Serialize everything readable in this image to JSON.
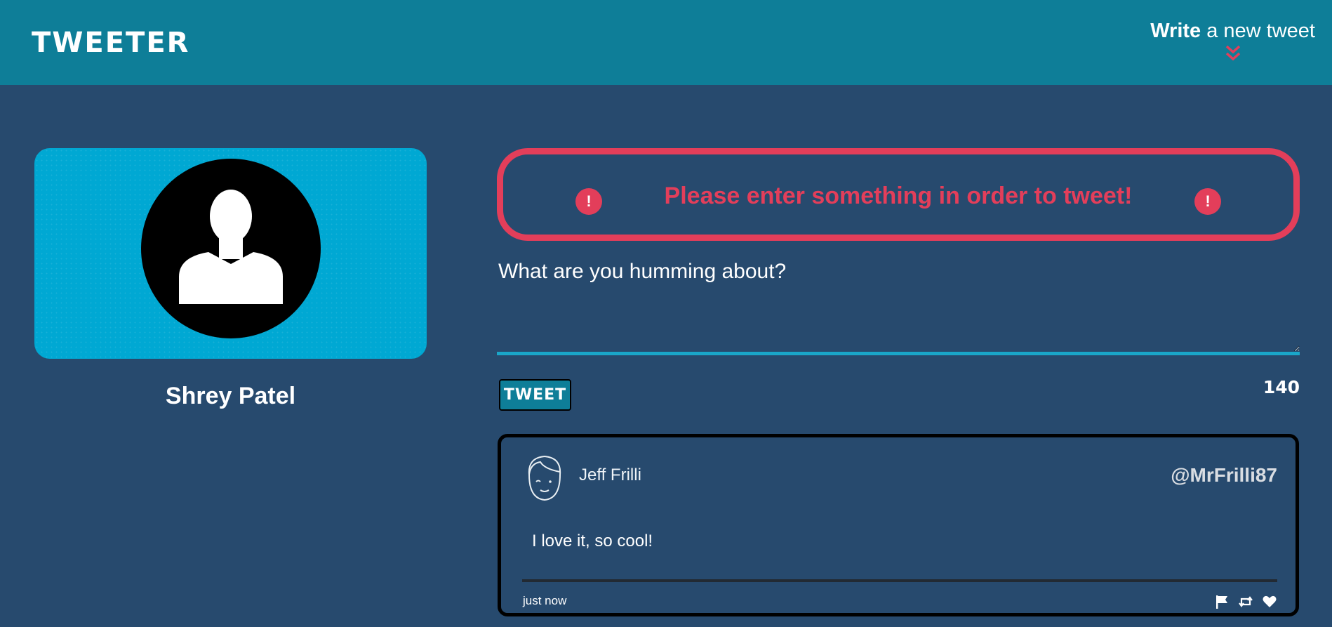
{
  "nav": {
    "brand": "TWEETER",
    "compose_bold": "Write",
    "compose_rest": " a new tweet"
  },
  "profile": {
    "name": "Shrey Patel"
  },
  "error": {
    "message": "Please enter something in order to tweet!",
    "icon_glyph": "!"
  },
  "composer": {
    "placeholder": "What are you humming about?",
    "button_label": "TWEET",
    "char_count": "140"
  },
  "tweets": [
    {
      "author": "Jeff Frilli",
      "handle": "@MrFrilli87",
      "body": "I love it, so cool!",
      "time": "just now"
    }
  ],
  "colors": {
    "nav_bg": "#0e7e98",
    "page_bg": "#274a6e",
    "error": "#e33e5a",
    "profile_card": "#00a8d3"
  },
  "icons": {
    "compose": "double-chevron-down-icon",
    "error": "exclamation-circle-icon",
    "flag": "flag-icon",
    "retweet": "retweet-icon",
    "like": "heart-icon"
  }
}
